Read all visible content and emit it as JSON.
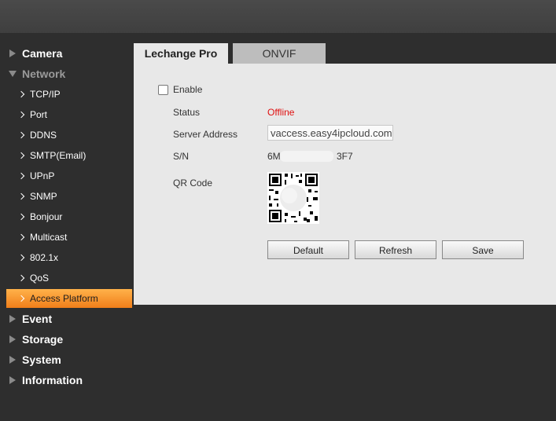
{
  "sidebar": {
    "camera": "Camera",
    "network": "Network",
    "network_items": [
      "TCP/IP",
      "Port",
      "DDNS",
      "SMTP(Email)",
      "UPnP",
      "SNMP",
      "Bonjour",
      "Multicast",
      "802.1x",
      "QoS",
      "Access Platform"
    ],
    "active_item": "Access Platform",
    "event": "Event",
    "storage": "Storage",
    "system": "System",
    "information": "Information"
  },
  "tabs": {
    "active": "Lechange Pro",
    "other": "ONVIF"
  },
  "form": {
    "enable_label": "Enable",
    "enable_checked": false,
    "status_label": "Status",
    "status_value": "Offline",
    "server_label": "Server Address",
    "server_value": "vaccess.easy4ipcloud.com",
    "sn_label": "S/N",
    "sn_prefix": "6M",
    "sn_suffix": "3F7",
    "qr_label": "QR Code"
  },
  "buttons": {
    "default": "Default",
    "refresh": "Refresh",
    "save": "Save"
  },
  "colors": {
    "active_nav": "#f39a30",
    "offline": "#e01010"
  }
}
